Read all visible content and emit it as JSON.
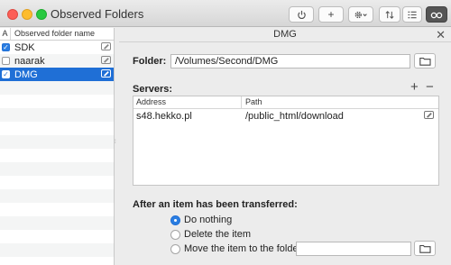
{
  "window": {
    "title": "Observed Folders"
  },
  "toolbar": {
    "power_icon": "power-icon",
    "add_label": "+",
    "gear_icon": "gear-icon",
    "sort_icon": "sort-arrows-icon",
    "list_icon": "list-icon",
    "view_icon": "glasses-icon"
  },
  "sidebar": {
    "col_a": "A",
    "col_name": "Observed folder name",
    "items": [
      {
        "label": "SDK",
        "checked": true,
        "selected": false
      },
      {
        "label": "naarak",
        "checked": false,
        "selected": false
      },
      {
        "label": "DMG",
        "checked": true,
        "selected": true
      }
    ]
  },
  "detail": {
    "title": "DMG",
    "close_label": "✕",
    "folder_label": "Folder:",
    "folder_value": "/Volumes/Second/DMG",
    "servers_label": "Servers:",
    "add_label": "+",
    "remove_label": "−",
    "table": {
      "headers": [
        "Address",
        "Path"
      ],
      "rows": [
        {
          "address": "s48.hekko.pl",
          "path": "/public_html/download"
        }
      ]
    },
    "after_label": "After an item has been transferred:",
    "options": [
      "Do nothing",
      "Delete the item",
      "Move the item to the folder:"
    ],
    "selected_option": "Do nothing",
    "move_folder_value": ""
  },
  "colors": {
    "selection": "#1f6fd6",
    "checkbox_on": "#2a7de1"
  }
}
